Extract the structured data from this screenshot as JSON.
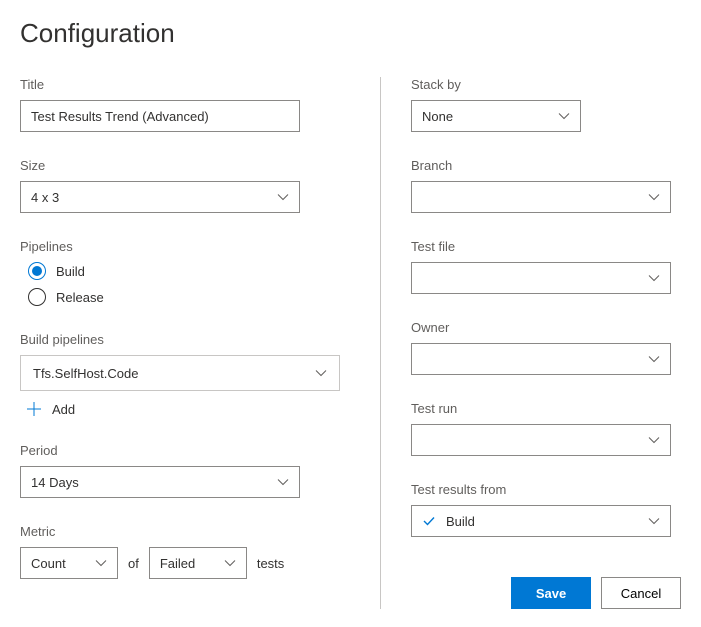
{
  "header": {
    "title": "Configuration"
  },
  "left": {
    "title": {
      "label": "Title",
      "value": "Test Results Trend (Advanced)"
    },
    "size": {
      "label": "Size",
      "value": "4 x 3"
    },
    "pipelines": {
      "label": "Pipelines",
      "options": [
        {
          "label": "Build",
          "checked": true
        },
        {
          "label": "Release",
          "checked": false
        }
      ]
    },
    "build_pipelines": {
      "label": "Build pipelines",
      "value": "Tfs.SelfHost.Code",
      "add_label": "Add"
    },
    "period": {
      "label": "Period",
      "value": "14 Days"
    },
    "metric": {
      "label": "Metric",
      "first": "Count",
      "middle": "of",
      "second": "Failed",
      "suffix": "tests"
    }
  },
  "right": {
    "stack_by": {
      "label": "Stack by",
      "value": "None"
    },
    "branch": {
      "label": "Branch",
      "value": ""
    },
    "test_file": {
      "label": "Test file",
      "value": ""
    },
    "owner": {
      "label": "Owner",
      "value": ""
    },
    "test_run": {
      "label": "Test run",
      "value": ""
    },
    "results_from": {
      "label": "Test results from",
      "value": "Build"
    }
  },
  "buttons": {
    "save": "Save",
    "cancel": "Cancel"
  }
}
